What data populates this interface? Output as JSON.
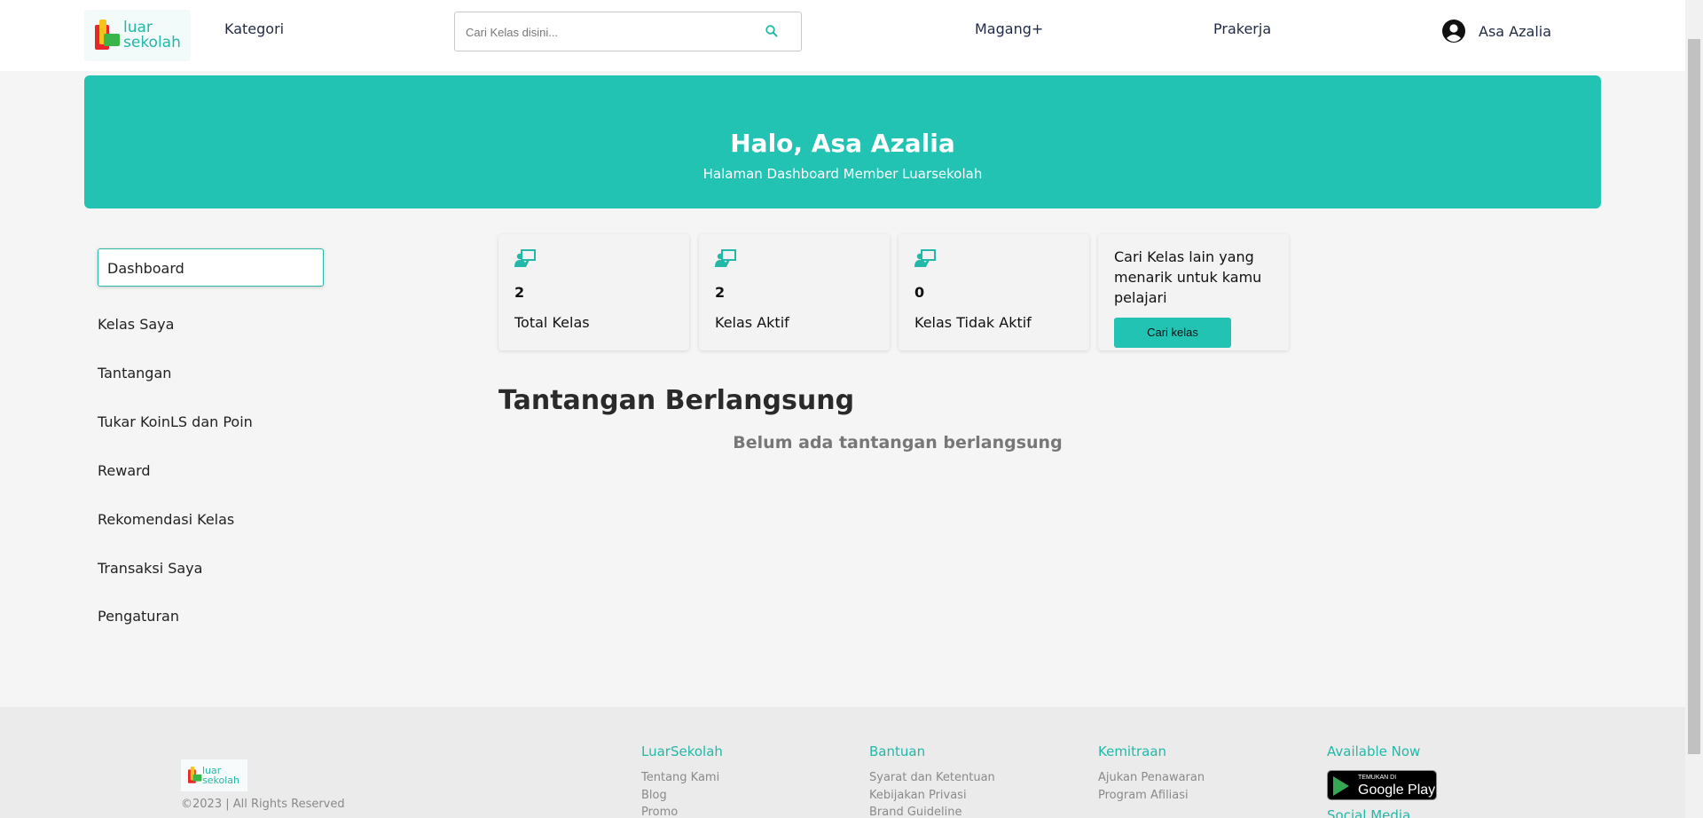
{
  "navbar": {
    "logo_text_line1": "luar",
    "logo_text_line2": "sekolah",
    "kategori": "Kategori",
    "search_placeholder": "Cari Kelas disini...",
    "magang": "Magang+",
    "prakerja": "Prakerja",
    "user_name": "Asa Azalia"
  },
  "banner": {
    "title": "Halo, Asa Azalia",
    "subtitle": "Halaman Dashboard Member Luarsekolah"
  },
  "sidebar": {
    "items": [
      {
        "label": "Dashboard"
      },
      {
        "label": "Kelas Saya"
      },
      {
        "label": "Tantangan"
      },
      {
        "label": "Tukar KoinLS dan Poin"
      },
      {
        "label": "Reward"
      },
      {
        "label": "Rekomendasi Kelas"
      },
      {
        "label": "Transaksi Saya"
      },
      {
        "label": "Pengaturan"
      }
    ]
  },
  "stats": [
    {
      "value": "2",
      "label": "Total Kelas"
    },
    {
      "value": "2",
      "label": "Kelas Aktif"
    },
    {
      "value": "0",
      "label": "Kelas Tidak Aktif"
    }
  ],
  "cta": {
    "text": "Cari Kelas lain yang menarik untuk kamu pelajari",
    "button": "Cari kelas"
  },
  "challenges": {
    "title": "Tantangan Berlangsung",
    "empty": "Belum ada tantangan berlangsung"
  },
  "footer": {
    "copyright": "©2023 | All Rights Reserved",
    "columns": [
      {
        "heading": "LuarSekolah",
        "links": [
          "Tentang Kami",
          "Blog",
          "Promo"
        ]
      },
      {
        "heading": "Bantuan",
        "links": [
          "Syarat dan Ketentuan",
          "Kebijakan Privasi",
          "Brand Guideline"
        ]
      },
      {
        "heading": "Kemitraan",
        "links": [
          "Ajukan Penawaran",
          "Program Afiliasi"
        ]
      }
    ],
    "available_now": "Available Now",
    "play_small": "TEMUKAN DI",
    "play_big": "Google Play",
    "social_media": "Social Media"
  },
  "colors": {
    "accent": "#23c3b4",
    "background": "#f5f5f5",
    "footer_bg": "#ebebeb"
  }
}
